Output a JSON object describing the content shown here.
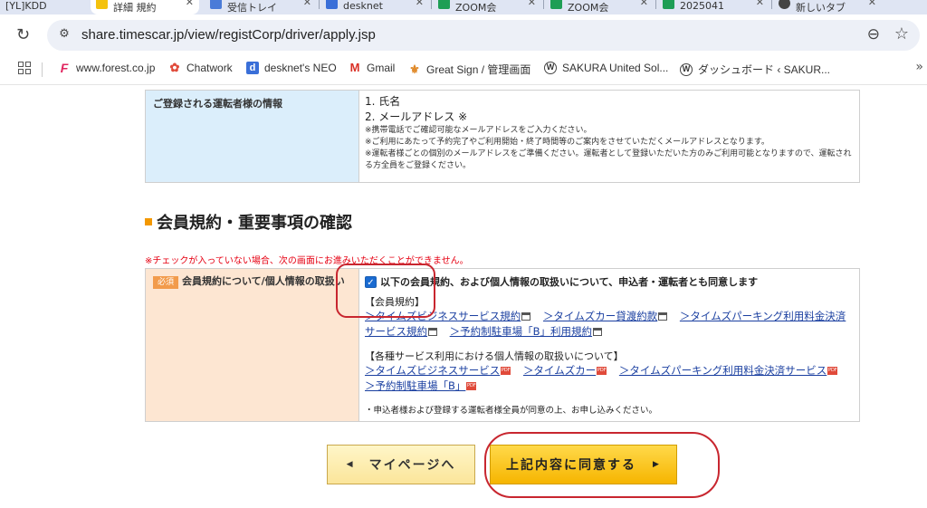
{
  "browser": {
    "tabs": [
      {
        "label": "[YL]KDD",
        "icon_color": "#999999",
        "active": false
      },
      {
        "label": "詳細 規約",
        "icon_color": "#f4c20d",
        "active": true
      },
      {
        "label": "受信トレイ",
        "icon_color": "#4a7bd8",
        "active": false
      },
      {
        "label": "desknet",
        "icon_color": "#3a6fd8",
        "active": false
      },
      {
        "label": "ZOOM会",
        "icon_color": "#1e9e55",
        "active": false
      },
      {
        "label": "ZOOM会",
        "icon_color": "#1e9e55",
        "active": false
      },
      {
        "label": "2025041",
        "icon_color": "#1e9e55",
        "active": false
      },
      {
        "label": "新しいタブ",
        "icon_color": "#444444",
        "active": false
      }
    ],
    "url": "share.timescar.jp/view/registCorp/driver/apply.jsp",
    "bookmarks": [
      {
        "label": "www.forest.co.jp",
        "icon": "F",
        "icon_color": "#e0245e"
      },
      {
        "label": "Chatwork",
        "icon": "✿",
        "icon_color": "#e04a3a"
      },
      {
        "label": "desknet's NEO",
        "icon": "d",
        "icon_color": "#3a6fd8"
      },
      {
        "label": "Gmail",
        "icon": "M",
        "icon_color": "#d93025"
      },
      {
        "label": "Great Sign / 管理画面",
        "icon": "⚜",
        "icon_color": "#e08a2a"
      },
      {
        "label": "SAKURA United Sol...",
        "icon": "W",
        "icon_color": "#444444"
      },
      {
        "label": "ダッシュボード ‹ SAKUR...",
        "icon": "W",
        "icon_color": "#444444"
      }
    ]
  },
  "driver_info": {
    "label": "ご登録される運転者様の情報",
    "item1": "1. 氏名",
    "item2": "2. メールアドレス ※",
    "note1": "※携帯電話でご確認可能なメールアドレスをご入力ください。",
    "note2": "※ご利用にあたって予約完了やご利用開始・終了時間等のご案内をさせていただくメールアドレスとなります。",
    "note3": "※運転者様ごとの個別のメールアドレスをご準備ください。運転者として登録いただいた方のみご利用可能となりますので、運転される方全員をご登録ください。"
  },
  "section": {
    "title": "会員規約・重要事項の確認",
    "warning": "※チェックが入っていない場合、次の画面にお進みいただくことができません。"
  },
  "agreement": {
    "badge": "必須",
    "label": "会員規約について/個人情報の取扱い",
    "checkbox_label": "以下の会員規約、および個人情報の取扱いについて、申込者・運転者とも同意します",
    "checked": true,
    "terms_head": "【会員規約】",
    "terms_links": [
      "＞タイムズビジネスサービス規約",
      "＞タイムズカー貸渡約款",
      "＞タイムズパーキング利用料金決済サービス規約",
      "＞予約制駐車場「B」利用規約"
    ],
    "privacy_head": "【各種サービス利用における個人情報の取扱いについて】",
    "privacy_links": [
      "＞タイムズビジネスサービス",
      "＞タイムズカー",
      "＞タイムズパーキング利用料金決済サービス",
      "＞予約制駐車場「B」"
    ],
    "footnote": "・申込者様および登録する運転者様全員が同意の上、お申し込みください。"
  },
  "buttons": {
    "mypage": "マイページへ",
    "agree": "上記内容に同意する"
  },
  "colors": {
    "accent": "#f39800",
    "annotation": "#c8262f",
    "link": "#1a3fa0"
  }
}
